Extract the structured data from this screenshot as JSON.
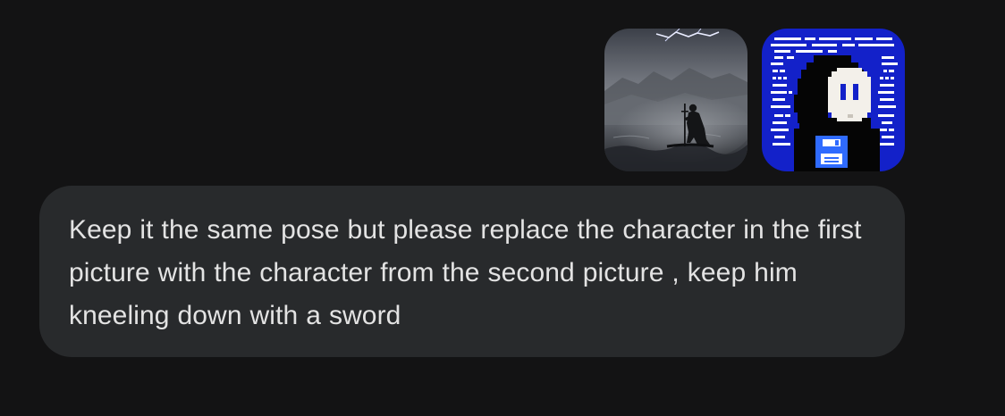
{
  "attachments": [
    {
      "name": "knight-in-storm-image",
      "kind": "photo"
    },
    {
      "name": "pixel-hooded-character-image",
      "kind": "pixel-art"
    }
  ],
  "message": {
    "text": "Keep it the same pose but please replace the character in the first picture with the character from the second picture , keep him kneeling down with a sword"
  },
  "colors": {
    "background": "#131314",
    "bubble": "#282a2c",
    "text": "#e3e3e3",
    "pixel_blue": "#1321c9"
  }
}
